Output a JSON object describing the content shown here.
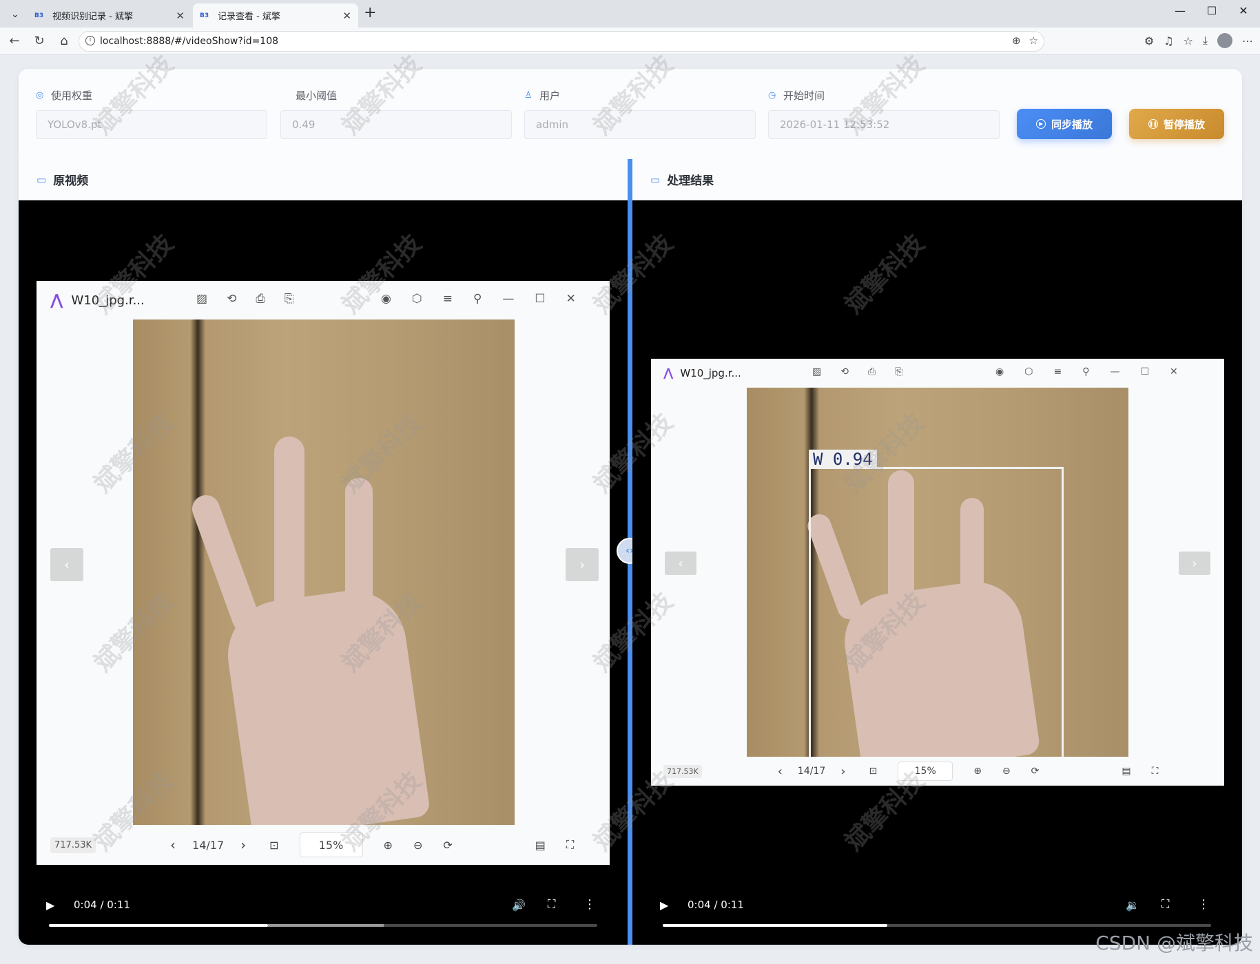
{
  "browser": {
    "tabs": [
      {
        "label": "视频识别记录 - 斌擎",
        "active": false
      },
      {
        "label": "记录查看 - 斌擎",
        "active": true
      }
    ],
    "url": "localhost:8888/#/videoShow?id=108"
  },
  "header": {
    "fields": [
      {
        "label": "使用权重",
        "value": "YOLOv8.pt"
      },
      {
        "label": "最小阈值",
        "value": "0.49"
      },
      {
        "label": "用户",
        "value": "admin"
      },
      {
        "label": "开始时间",
        "value": "2026-01-11 12:53:52"
      }
    ],
    "sync_button": "同步播放",
    "pause_button": "暂停播放"
  },
  "left_panel": {
    "title": "原视频",
    "viewer": {
      "filename": "W10_jpg.r...",
      "size": "717.53K",
      "page": "14/17",
      "zoom": "15%"
    },
    "player": {
      "time": "0:04 / 0:11",
      "progress": 0.4,
      "buffered": 0.61
    }
  },
  "right_panel": {
    "title": "处理结果",
    "viewer": {
      "filename": "W10_jpg.r...",
      "size": "717.53K",
      "page": "14/17",
      "zoom": "15%",
      "detection": {
        "label": "W 0.94"
      }
    },
    "player": {
      "time": "0:04 / 0:11",
      "progress": 0.41,
      "buffered": 0.41
    }
  },
  "watermark": "斌擎科技",
  "footer_credit": "CSDN @斌擎科技"
}
